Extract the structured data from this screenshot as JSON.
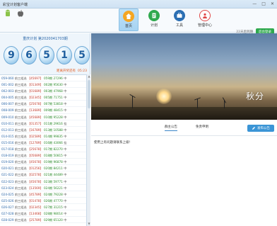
{
  "window": {
    "title": "彩宝计划客户端",
    "controls": [
      "—",
      "□",
      "✕"
    ]
  },
  "nav": [
    {
      "label": "首页",
      "icon": "home-icon",
      "active": true
    },
    {
      "label": "计划",
      "icon": "plan-icon",
      "active": false
    },
    {
      "label": "工具",
      "icon": "tools-icon",
      "active": false
    },
    {
      "label": "管理中心",
      "icon": "management-icon",
      "active": false
    }
  ],
  "header": {
    "days_left": "22天后到期",
    "login_label": "后台登录"
  },
  "plan": {
    "title": "重庆计划  第2020041703期",
    "numbers": [
      "9",
      "6",
      "5",
      "1",
      "5"
    ],
    "countdown_label": "距离开奖还有",
    "countdown_value": "05:23"
  },
  "history": [
    {
      "p": "059-060",
      "t": "前三组选",
      "n": "【45697】",
      "m": "059期 27296",
      "s": "中"
    },
    {
      "p": "001-002",
      "t": "前三组选",
      "n": "【01349】",
      "m": "002期 95630",
      "s": "中"
    },
    {
      "p": "002-003",
      "t": "前三组选",
      "n": "【01689】",
      "m": "003期 47968",
      "s": "中"
    },
    {
      "p": "004-005",
      "t": "前三组选",
      "n": "【02345】",
      "m": "005期 71751",
      "s": "中"
    },
    {
      "p": "006-007",
      "t": "前三组选",
      "n": "【25678】",
      "m": "007期 53818",
      "s": "中"
    },
    {
      "p": "008-009",
      "t": "前三组选",
      "n": "【13689】",
      "m": "009期 48415",
      "s": "中"
    },
    {
      "p": "009-010",
      "t": "前三组选",
      "n": "【45689】",
      "m": "010期 95228",
      "s": "中"
    },
    {
      "p": "010-011",
      "t": "前三组选",
      "n": "【01357】",
      "m": "011期 29616",
      "s": "挂"
    },
    {
      "p": "012-013",
      "t": "前三组选",
      "n": "【16789】",
      "m": "013期 10588",
      "s": "中"
    },
    {
      "p": "014-015",
      "t": "前三组选",
      "n": "【02589】",
      "m": "014期 99835",
      "s": "中"
    },
    {
      "p": "015-016",
      "t": "前三组选",
      "n": "【12789】",
      "m": "016期 43066",
      "s": "挂"
    },
    {
      "p": "017-018",
      "t": "前三组选",
      "n": "【25678】",
      "m": "017期 82270",
      "s": "中"
    },
    {
      "p": "018-019",
      "t": "前三组选",
      "n": "【05689】",
      "m": "018期 50815",
      "s": "中"
    },
    {
      "p": "019-020",
      "t": "前三组选",
      "n": "【45678】",
      "m": "019期 96878",
      "s": "中"
    },
    {
      "p": "020-021",
      "t": "前三组选",
      "n": "【01256】",
      "m": "020期 84211",
      "s": "中"
    },
    {
      "p": "021-022",
      "t": "前三组选",
      "n": "【02578】",
      "m": "021期 44489",
      "s": "中"
    },
    {
      "p": "022-023",
      "t": "前三组选",
      "n": "【45678】",
      "m": "023期 59771",
      "s": "中"
    },
    {
      "p": "023-024",
      "t": "前三组选",
      "n": "【13569】",
      "m": "024期 56221",
      "s": "中"
    },
    {
      "p": "024-025",
      "t": "前三组选",
      "n": "【45789】",
      "m": "024期 79228",
      "s": "中"
    },
    {
      "p": "025-026",
      "t": "前三组选",
      "n": "【01478】",
      "m": "026期 47770",
      "s": "中"
    },
    {
      "p": "026-027",
      "t": "前三组选",
      "n": "【02345】",
      "m": "027期 31215",
      "s": "中"
    },
    {
      "p": "027-028",
      "t": "前三组选",
      "n": "【13468】",
      "m": "028期 98014",
      "s": "中"
    },
    {
      "p": "028-029",
      "t": "前三组选",
      "n": "【25789】",
      "m": "029期 65120",
      "s": "中"
    }
  ],
  "banner": {
    "text": "秋分"
  },
  "tabs": [
    {
      "label": "群主公告",
      "active": true
    },
    {
      "label": "免责申明",
      "active": false
    }
  ],
  "post_button": "发布公告",
  "content_msg": "使用上有问题请联系上级!"
}
